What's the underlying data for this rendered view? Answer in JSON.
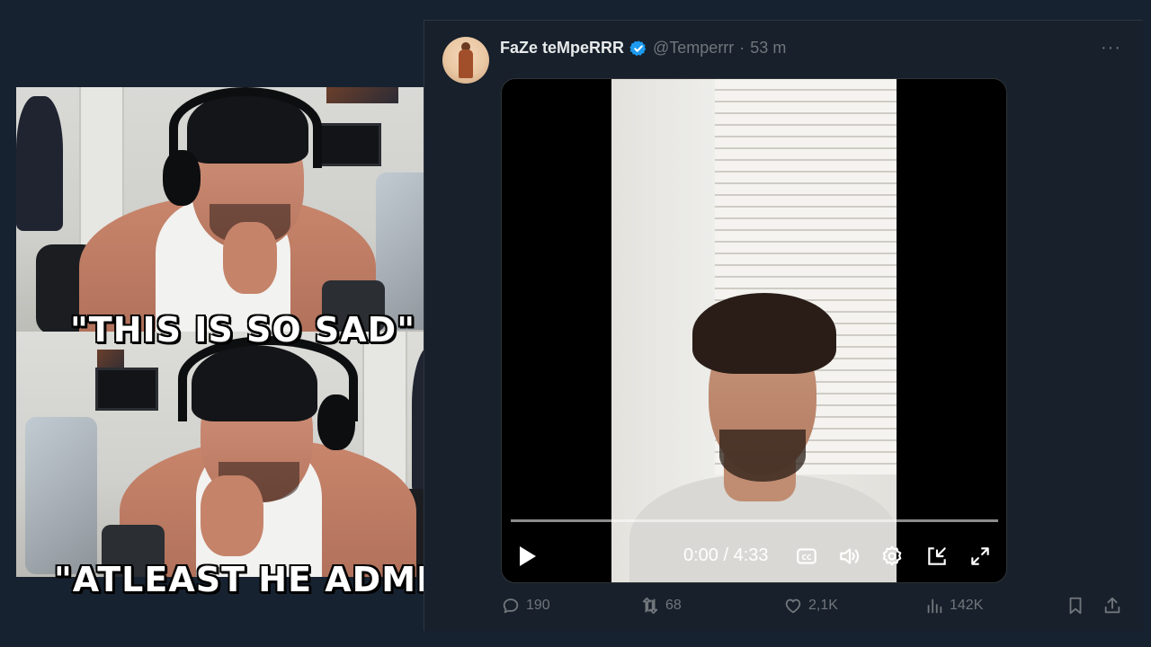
{
  "captions": {
    "top": "\"THIS IS SO SAD\"",
    "bottom": "\"ATLEAST HE ADMIT IT\""
  },
  "tweet": {
    "display_name": "FaZe teMpeRRR",
    "handle": "@Temperrr",
    "separator": "·",
    "time": "53 m",
    "video": {
      "timecode": "0:00 / 4:33",
      "progress": 0
    },
    "stats": {
      "replies": "190",
      "reposts": "68",
      "likes": "2,1K",
      "views": "142K"
    }
  },
  "colors": {
    "background": "#172230",
    "card": "#17202b",
    "verified": "#1d9bf0",
    "muted": "#71767b"
  }
}
